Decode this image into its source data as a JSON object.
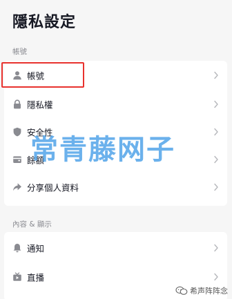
{
  "page_title": "隱私設定",
  "sections": [
    {
      "label": "帳號",
      "items": [
        {
          "label": "帳號",
          "icon": "person-icon"
        },
        {
          "label": "隱私權",
          "icon": "lock-icon"
        },
        {
          "label": "安全性",
          "icon": "shield-icon"
        },
        {
          "label": "餘額",
          "icon": "wallet-icon"
        },
        {
          "label": "分享個人資料",
          "icon": "share-arrow-icon"
        }
      ]
    },
    {
      "label": "內容 & 顯示",
      "items": [
        {
          "label": "通知",
          "icon": "bell-icon"
        },
        {
          "label": "直播",
          "icon": "live-tv-icon"
        }
      ]
    }
  ],
  "watermark": "常青藤网子",
  "source_mark": "希声阵阵念",
  "colors": {
    "background": "#f6f6f6",
    "card": "#ffffff",
    "highlight_border": "#e8312d",
    "watermark": "#4aa0e8",
    "icon": "#8a8b91"
  }
}
